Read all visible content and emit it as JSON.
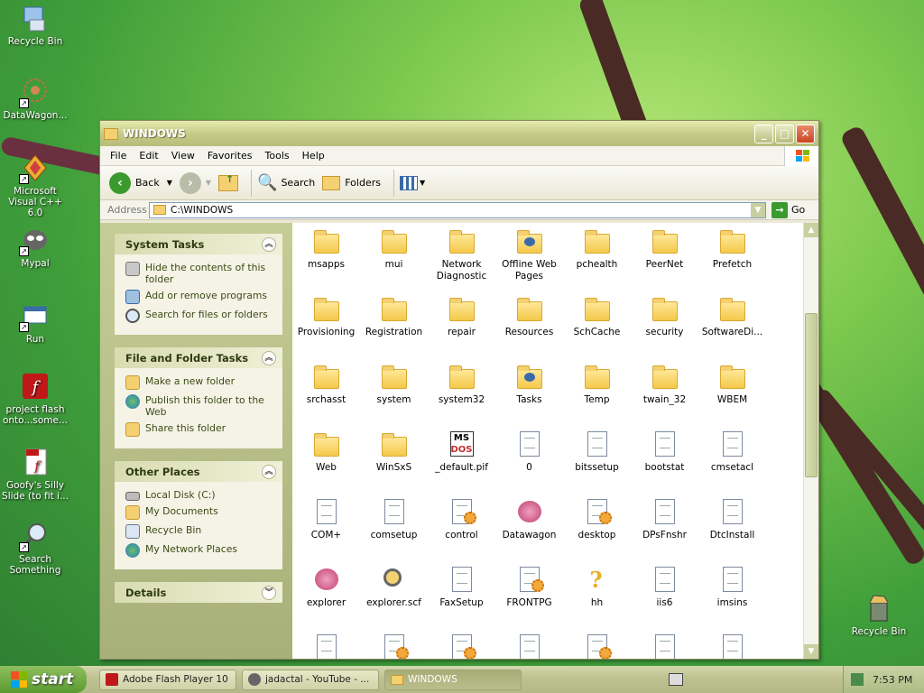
{
  "desktop": {
    "icons": [
      {
        "label": "Recycle Bin"
      },
      {
        "label": "DataWagon..."
      },
      {
        "label": "Microsoft Visual C++ 6.0"
      },
      {
        "label": "Mypal"
      },
      {
        "label": "Run"
      },
      {
        "label": "project flash onto...some..."
      },
      {
        "label": "Goofy's Silly Slide (to fit i..."
      },
      {
        "label": "Search Something"
      },
      {
        "label": "Recycle Bin"
      }
    ]
  },
  "window": {
    "title": "WINDOWS",
    "menu": [
      "File",
      "Edit",
      "View",
      "Favorites",
      "Tools",
      "Help"
    ],
    "toolbar": {
      "back": "Back",
      "search": "Search",
      "folders": "Folders"
    },
    "address": {
      "label": "Address",
      "value": "C:\\WINDOWS",
      "go": "Go"
    },
    "taskpane": {
      "system_tasks": {
        "title": "System Tasks",
        "items": [
          "Hide the contents of this folder",
          "Add or remove programs",
          "Search for files or folders"
        ]
      },
      "file_folder_tasks": {
        "title": "File and Folder Tasks",
        "items": [
          "Make a new folder",
          "Publish this folder to the Web",
          "Share this folder"
        ]
      },
      "other_places": {
        "title": "Other Places",
        "items": [
          "Local Disk (C:)",
          "My Documents",
          "Recycle Bin",
          "My Network Places"
        ]
      },
      "details": {
        "title": "Details"
      }
    },
    "files": [
      {
        "name": "msapps",
        "type": "folder"
      },
      {
        "name": "mui",
        "type": "folder"
      },
      {
        "name": "Network Diagnostic",
        "type": "folder"
      },
      {
        "name": "Offline Web Pages",
        "type": "folder-special"
      },
      {
        "name": "pchealth",
        "type": "folder"
      },
      {
        "name": "PeerNet",
        "type": "folder"
      },
      {
        "name": "Prefetch",
        "type": "folder"
      },
      {
        "name": "Provisioning",
        "type": "folder"
      },
      {
        "name": "Registration",
        "type": "folder"
      },
      {
        "name": "repair",
        "type": "folder"
      },
      {
        "name": "Resources",
        "type": "folder"
      },
      {
        "name": "SchCache",
        "type": "folder"
      },
      {
        "name": "security",
        "type": "folder"
      },
      {
        "name": "SoftwareDi...",
        "type": "folder"
      },
      {
        "name": "srchasst",
        "type": "folder"
      },
      {
        "name": "system",
        "type": "folder"
      },
      {
        "name": "system32",
        "type": "folder"
      },
      {
        "name": "Tasks",
        "type": "folder-special"
      },
      {
        "name": "Temp",
        "type": "folder"
      },
      {
        "name": "twain_32",
        "type": "folder"
      },
      {
        "name": "WBEM",
        "type": "folder"
      },
      {
        "name": "Web",
        "type": "folder"
      },
      {
        "name": "WinSxS",
        "type": "folder"
      },
      {
        "name": "_default.pif",
        "type": "pif"
      },
      {
        "name": "0",
        "type": "doc"
      },
      {
        "name": "bitssetup",
        "type": "doc"
      },
      {
        "name": "bootstat",
        "type": "exe"
      },
      {
        "name": "cmsetacl",
        "type": "doc"
      },
      {
        "name": "COM+",
        "type": "doc"
      },
      {
        "name": "comsetup",
        "type": "doc"
      },
      {
        "name": "control",
        "type": "config"
      },
      {
        "name": "Datawagon",
        "type": "app"
      },
      {
        "name": "desktop",
        "type": "config"
      },
      {
        "name": "DPsFnshr",
        "type": "doc"
      },
      {
        "name": "DtcInstall",
        "type": "doc"
      },
      {
        "name": "explorer",
        "type": "app"
      },
      {
        "name": "explorer.scf",
        "type": "search"
      },
      {
        "name": "FaxSetup",
        "type": "doc"
      },
      {
        "name": "FRONTPG",
        "type": "config"
      },
      {
        "name": "hh",
        "type": "help"
      },
      {
        "name": "iis6",
        "type": "doc"
      },
      {
        "name": "imsins",
        "type": "doc"
      },
      {
        "name": "",
        "type": "exe"
      },
      {
        "name": "",
        "type": "config"
      },
      {
        "name": "",
        "type": "config"
      },
      {
        "name": "",
        "type": "doc"
      },
      {
        "name": "",
        "type": "config"
      },
      {
        "name": "",
        "type": "doc"
      },
      {
        "name": "",
        "type": "doc"
      }
    ]
  },
  "taskbar": {
    "start": "start",
    "buttons": [
      "Adobe Flash Player 10",
      "jadactal - YouTube - ...",
      "WINDOWS"
    ],
    "clock": "7:53 PM"
  }
}
